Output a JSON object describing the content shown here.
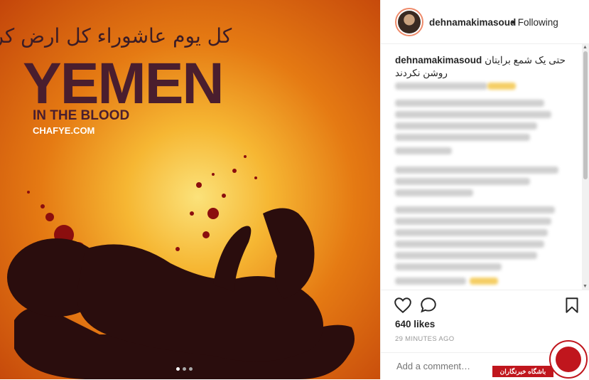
{
  "image": {
    "arabic_line": "کل یوم عاشوراء کل ارض کربلاء",
    "title": "YEMEN",
    "subtitle": "IN THE BLOOD",
    "site": "CHAFYE.COM",
    "dots": 3,
    "active_dot": 0
  },
  "header": {
    "username": "dehnamakimasoud",
    "separator": "•",
    "follow_status": "Following"
  },
  "caption": {
    "username": "dehnamakimasoud",
    "text": "حتی یک شمع برایتان روشن نکردند"
  },
  "actions": {
    "likes": "640 likes",
    "time": "29 MINUTES AGO"
  },
  "comment": {
    "placeholder": "Add a comment…"
  },
  "watermark": {
    "text": "باشگاه خبرنگاران"
  },
  "colors": {
    "blood": "#8b0e0e",
    "accent": "#c0161d",
    "text": "#262626"
  }
}
